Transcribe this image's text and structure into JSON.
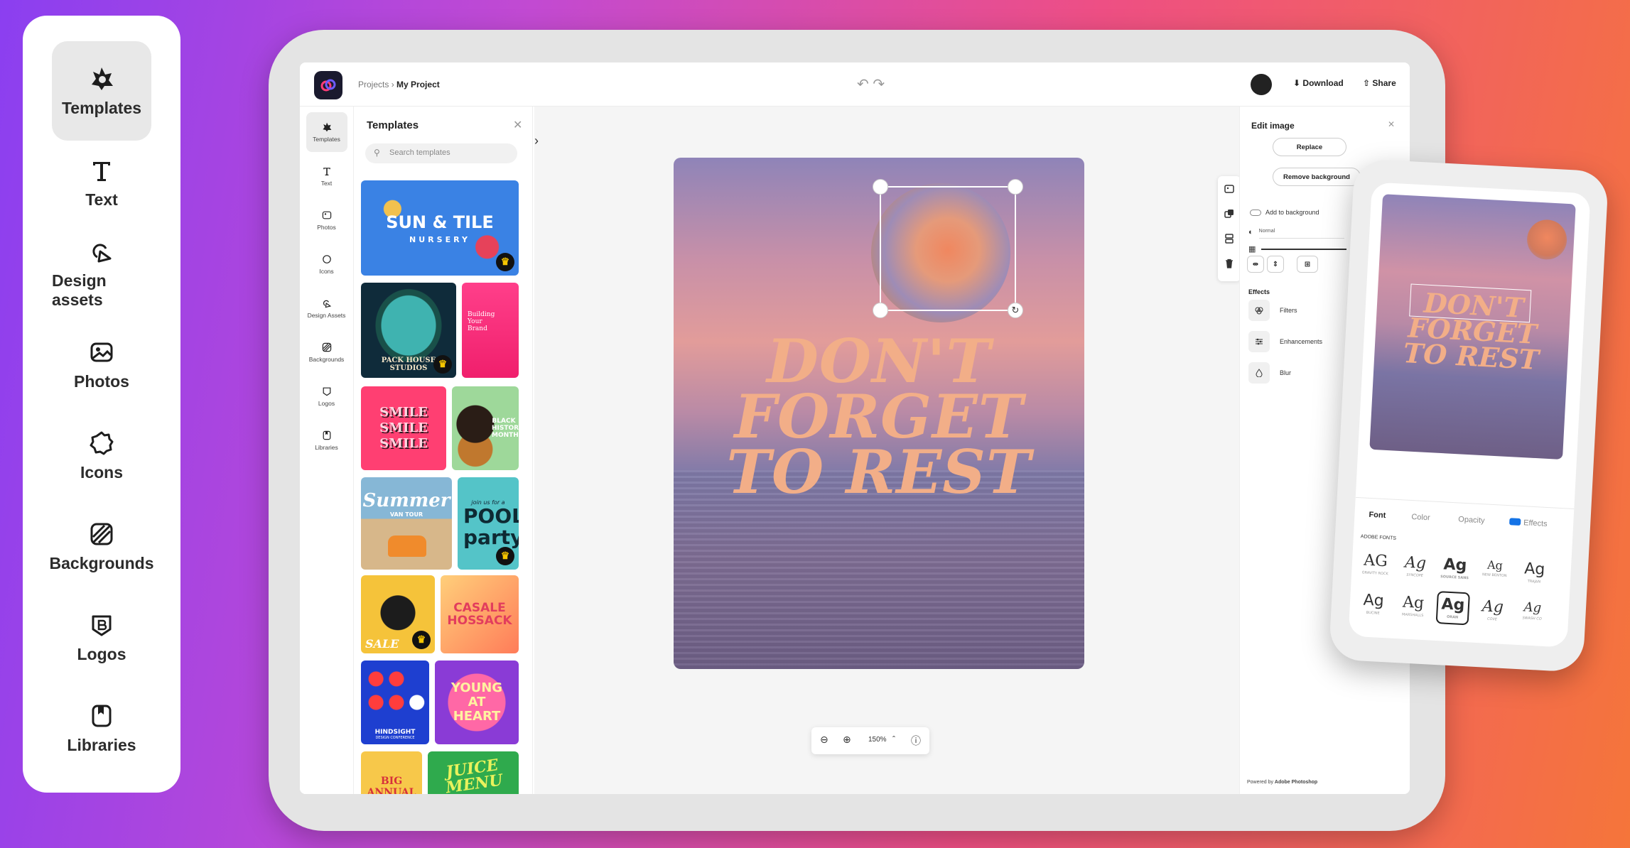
{
  "bignav": {
    "items": [
      {
        "label": "Templates",
        "icon": "templates-icon"
      },
      {
        "label": "Text",
        "icon": "text-icon"
      },
      {
        "label": "Design assets",
        "icon": "design-assets-icon"
      },
      {
        "label": "Photos",
        "icon": "photos-icon"
      },
      {
        "label": "Icons",
        "icon": "icons-icon"
      },
      {
        "label": "Backgrounds",
        "icon": "backgrounds-icon"
      },
      {
        "label": "Logos",
        "icon": "logos-icon"
      },
      {
        "label": "Libraries",
        "icon": "libraries-icon"
      }
    ]
  },
  "topbar": {
    "breadcrumb_root": "Projects",
    "breadcrumb_current": "My Project",
    "download_label": "Download",
    "share_label": "Share"
  },
  "rail": {
    "items": [
      "Templates",
      "Text",
      "Photos",
      "Icons",
      "Design Assets",
      "Backgrounds",
      "Logos",
      "Libraries"
    ]
  },
  "templates_panel": {
    "title": "Templates",
    "search_placeholder": "Search templates",
    "tiles": [
      {
        "text": "SUN & TILE",
        "sub": "NURSERY"
      },
      {
        "text": "PACK HOUSE STUDIOS"
      },
      {
        "text": "Building Your Brand"
      },
      {
        "text": "SMILE SMILE SMILE"
      },
      {
        "text": "BLACK HISTORY MONTH"
      },
      {
        "text": "Summer",
        "sub": "VAN TOUR"
      },
      {
        "text": "POOL party",
        "sub": "join us for a"
      },
      {
        "text": "SALE"
      },
      {
        "text": "CASALE HOSSACK"
      },
      {
        "text": "HINDSIGHT",
        "sub": "DESIGN CONFERENCE"
      },
      {
        "text": "YOUNG AT HEART"
      },
      {
        "text": "BIG ANNUAL"
      },
      {
        "text": "JUICE MENU"
      }
    ]
  },
  "canvas": {
    "headline_lines": [
      "DON'T",
      "FORGET",
      "TO REST"
    ],
    "zoom": "150%"
  },
  "edit_panel": {
    "title": "Edit image",
    "replace_label": "Replace",
    "remove_bg_label": "Remove background",
    "add_to_bg_label": "Add to background",
    "blend_mode": "Normal",
    "effects_heading": "Effects",
    "effects": [
      "Filters",
      "Enhancements",
      "Blur"
    ],
    "footer_prefix": "Powered by",
    "footer_brand": "Adobe Photoshop"
  },
  "phone": {
    "headline_lines": [
      "DON'T",
      "FORGET",
      "TO REST"
    ],
    "tabs": [
      "Font",
      "Color",
      "Opacity",
      "Effects"
    ],
    "fonts_heading": "ADOBE FONTS",
    "font_cells": [
      {
        "glyph": "AG",
        "name": "GRAVITY ROCK"
      },
      {
        "glyph": "Ag",
        "name": "SYNCOPE"
      },
      {
        "glyph": "Ag",
        "name": "SOURCE SANS"
      },
      {
        "glyph": "Ag",
        "name": "NEW BENTON"
      },
      {
        "glyph": "Ag",
        "name": "TRAJAN"
      },
      {
        "glyph": "Ag",
        "name": "BUCINE"
      },
      {
        "glyph": "Ag",
        "name": "MARSHALLS"
      },
      {
        "glyph": "Ag",
        "name": "ORAN"
      },
      {
        "glyph": "Ag",
        "name": "COVE"
      },
      {
        "glyph": "Ag",
        "name": "SWASH CO"
      }
    ]
  },
  "colors": {
    "accent": "#1473e6",
    "art_text": "#f2ae88",
    "crown": "#f7c600"
  }
}
